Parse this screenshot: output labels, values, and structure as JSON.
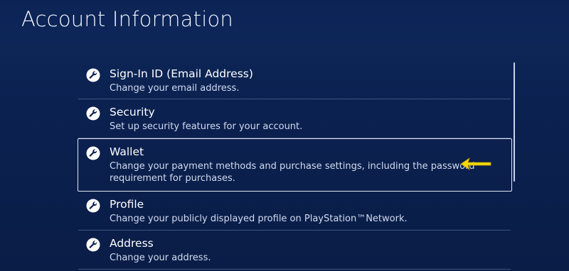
{
  "page": {
    "title": "Account Information"
  },
  "items": [
    {
      "title": "Sign-In ID (Email Address)",
      "description": "Change your email address.",
      "icon": "wrench-icon"
    },
    {
      "title": "Security",
      "description": "Set up security features for your account.",
      "icon": "wrench-icon"
    },
    {
      "title": "Wallet",
      "description": "Change your payment methods and purchase settings, including the password requirement for purchases.",
      "icon": "wrench-icon",
      "selected": true
    },
    {
      "title": "Profile",
      "description": "Change your publicly displayed profile on PlayStation™Network.",
      "icon": "wrench-icon"
    },
    {
      "title": "Address",
      "description": "Change your address.",
      "icon": "wrench-icon"
    }
  ],
  "colors": {
    "background": "#0b2150",
    "text": "#ffffff",
    "subtext": "#d2dbef",
    "focus_border": "#dfe7f7",
    "pointer": "#f5d90a"
  }
}
